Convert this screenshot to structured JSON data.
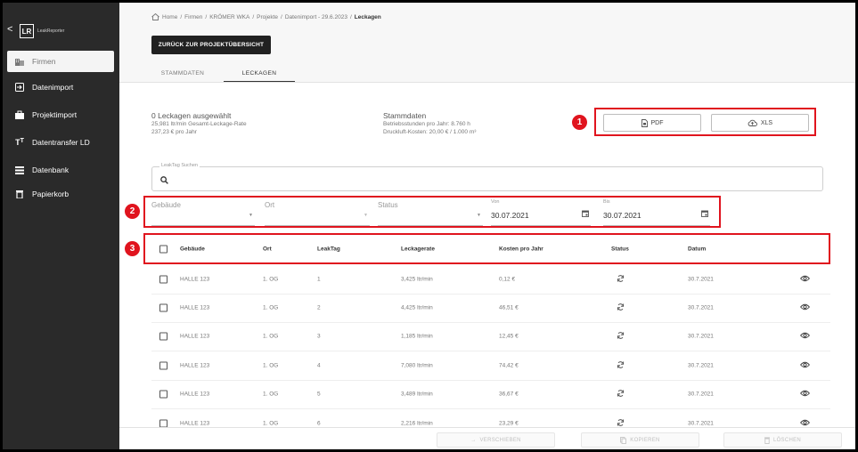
{
  "sidebar": {
    "collapse_glyph": "<",
    "logo": "LR",
    "logo_text": "LeakReporter",
    "items": [
      {
        "label": "Firmen",
        "icon": "building-icon",
        "active": true
      },
      {
        "label": "Datenimport",
        "icon": "import-icon",
        "active": false
      },
      {
        "label": "Projektimport",
        "icon": "briefcase-icon",
        "active": false
      },
      {
        "label": "Datentransfer LD",
        "icon": "text-transfer-icon",
        "active": false
      },
      {
        "label": "Datenbank",
        "icon": "database-list-icon",
        "active": false
      },
      {
        "label": "Papierkorb",
        "icon": "trash-icon",
        "active": false
      }
    ]
  },
  "breadcrumb": {
    "items": [
      "Home",
      "Firmen",
      "KRÖMER WKA",
      "Projekte",
      "Datenimport - 29.6.2023",
      "Leckagen"
    ],
    "separator": "/"
  },
  "header": {
    "back_label": "ZURÜCK ZUR PROJEKTÜBERSICHT",
    "tabs": [
      {
        "label": "STAMMDATEN",
        "active": false
      },
      {
        "label": "LECKAGEN",
        "active": true
      }
    ]
  },
  "summary": {
    "selected": "0 Leckagen ausgewählt",
    "rate": "25,981 ltr/min Gesamt-Leckage-Rate",
    "cost": "237,23 € pro Jahr",
    "master_title": "Stammdaten",
    "hours": "Betriebsstunden pro Jahr: 8.760 h",
    "air_cost": "Druckluft-Kosten: 20,00 € / 1.000 m³"
  },
  "export": {
    "pdf_label": "PDF",
    "xls_label": "XLS"
  },
  "badges": [
    "1",
    "2",
    "3"
  ],
  "search": {
    "label": "LeakTag Suchen",
    "value": ""
  },
  "filters": {
    "gebaeude_label": "Gebäude",
    "ort_label": "Ort",
    "status_label": "Status",
    "von_label": "Von",
    "von_value": "30.07.2021",
    "bis_label": "Bis",
    "bis_value": "30.07.2021"
  },
  "table": {
    "columns": [
      "Gebäude",
      "Ort",
      "LeakTag",
      "Leckagerate",
      "Kosten pro Jahr",
      "Status",
      "Datum"
    ],
    "rows": [
      {
        "gebaeude": "HALLE 123",
        "ort": "1. OG",
        "tag": "1",
        "rate": "3,425 ltr/min",
        "kosten": "0,12 €",
        "datum": "30.7.2021"
      },
      {
        "gebaeude": "HALLE 123",
        "ort": "1. OG",
        "tag": "2",
        "rate": "4,425 ltr/min",
        "kosten": "46,51 €",
        "datum": "30.7.2021"
      },
      {
        "gebaeude": "HALLE 123",
        "ort": "1. OG",
        "tag": "3",
        "rate": "1,185 ltr/min",
        "kosten": "12,45 €",
        "datum": "30.7.2021"
      },
      {
        "gebaeude": "HALLE 123",
        "ort": "1. OG",
        "tag": "4",
        "rate": "7,080 ltr/min",
        "kosten": "74,42 €",
        "datum": "30.7.2021"
      },
      {
        "gebaeude": "HALLE 123",
        "ort": "1. OG",
        "tag": "5",
        "rate": "3,489 ltr/min",
        "kosten": "36,67 €",
        "datum": "30.7.2021"
      },
      {
        "gebaeude": "HALLE 123",
        "ort": "1. OG",
        "tag": "6",
        "rate": "2,216 ltr/min",
        "kosten": "23,29 €",
        "datum": "30.7.2021"
      }
    ]
  },
  "footer": {
    "move_label": "VERSCHIEBEN",
    "copy_label": "KOPIEREN",
    "delete_label": "LÖSCHEN"
  },
  "colors": {
    "sidebar": "#2a2a2a",
    "accent_red": "#e0141e",
    "dark_button": "#212121"
  }
}
